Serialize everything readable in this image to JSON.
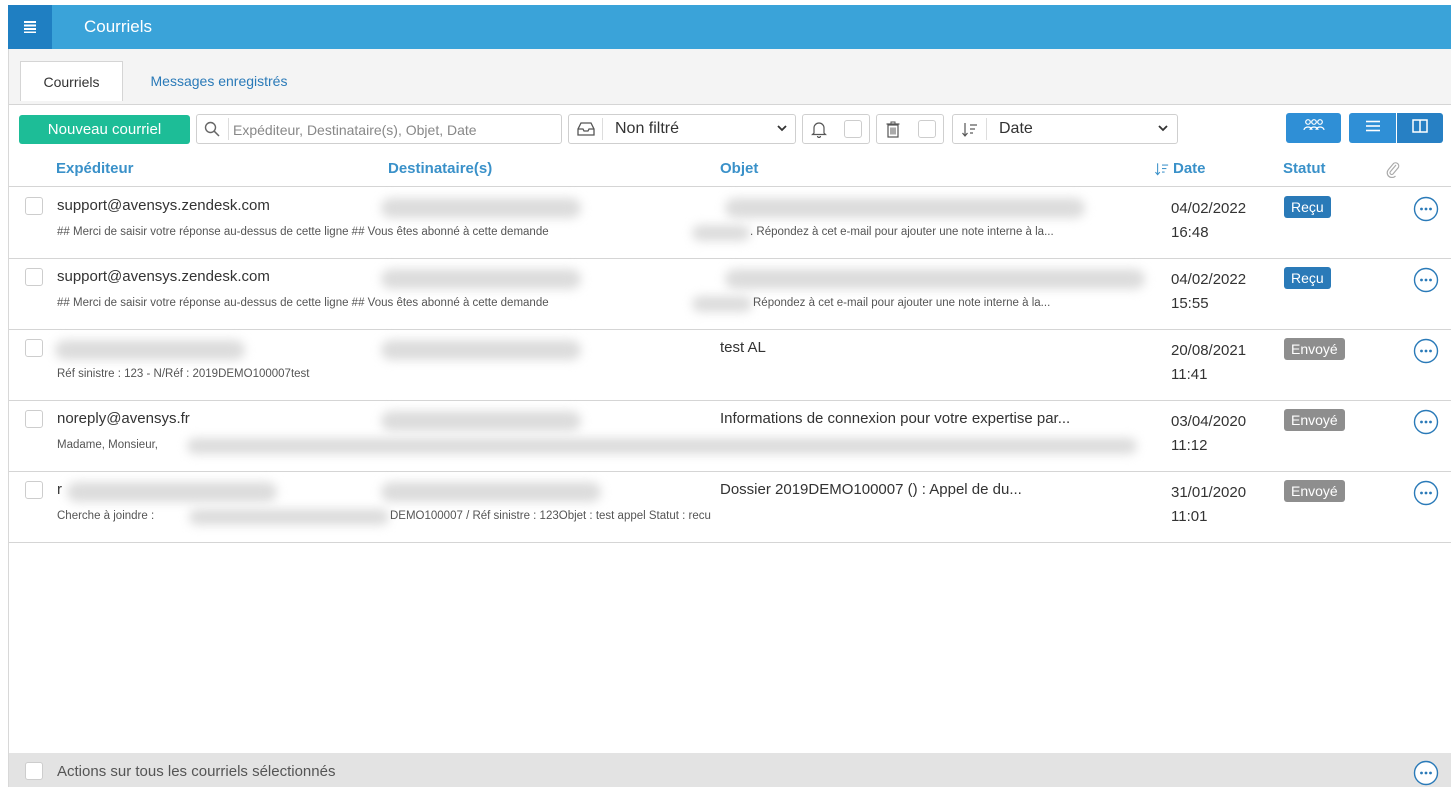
{
  "app": {
    "title": "Courriels",
    "accent_color": "#3aa3d9",
    "menu_icon": "hamburger-menu-icon"
  },
  "tabs": [
    {
      "label": "Courriels",
      "active": true
    },
    {
      "label": "Messages enregistrés",
      "active": false
    }
  ],
  "toolbar": {
    "new_label": "Nouveau courriel",
    "search_placeholder": "Expéditeur, Destinataire(s), Objet, Date",
    "filter_value": "Non filtré",
    "sort_value": "Date"
  },
  "columns": {
    "sender": "Expéditeur",
    "recipients": "Destinataire(s)",
    "subject": "Objet",
    "date": "Date",
    "status": "Statut"
  },
  "emails": [
    {
      "sender": "support@avensys.zendesk.com",
      "subject": "",
      "preview": "## Merci de saisir votre réponse au-dessus de cette ligne ## Vous êtes abonné à cette demande",
      "preview_tail": ". Répondez à cet e-mail pour ajouter une note interne à la...",
      "date": "04/02/2022",
      "time": "16:48",
      "status": "Reçu",
      "status_type": "recu"
    },
    {
      "sender": "support@avensys.zendesk.com",
      "subject": "",
      "preview": "## Merci de saisir votre réponse au-dessus de cette ligne ## Vous êtes abonné à cette demande",
      "preview_tail": "Répondez à cet e-mail pour ajouter une note interne à la...",
      "date": "04/02/2022",
      "time": "15:55",
      "status": "Reçu",
      "status_type": "recu"
    },
    {
      "sender": "",
      "subject": "test AL",
      "preview": "Réf sinistre : 123 - N/Réf : 2019DEMO100007test",
      "preview_tail": "",
      "date": "20/08/2021",
      "time": "11:41",
      "status": "Envoyé",
      "status_type": "envoye"
    },
    {
      "sender": "noreply@avensys.fr",
      "subject": "Informations de connexion pour votre expertise par...",
      "preview": "Madame, Monsieur,",
      "preview_tail": "",
      "date": "03/04/2020",
      "time": "11:12",
      "status": "Envoyé",
      "status_type": "envoye"
    },
    {
      "sender": "r",
      "subject": "Dossier 2019DEMO100007 () : Appel de du...",
      "preview": "Cherche à joindre :",
      "preview_tail": "DEMO100007 / Réf sinistre : 123Objet : test appel Statut : recu",
      "date": "31/01/2020",
      "time": "11:01",
      "status": "Envoyé",
      "status_type": "envoye"
    }
  ],
  "footer": {
    "label": "Actions sur tous les courriels sélectionnés"
  }
}
